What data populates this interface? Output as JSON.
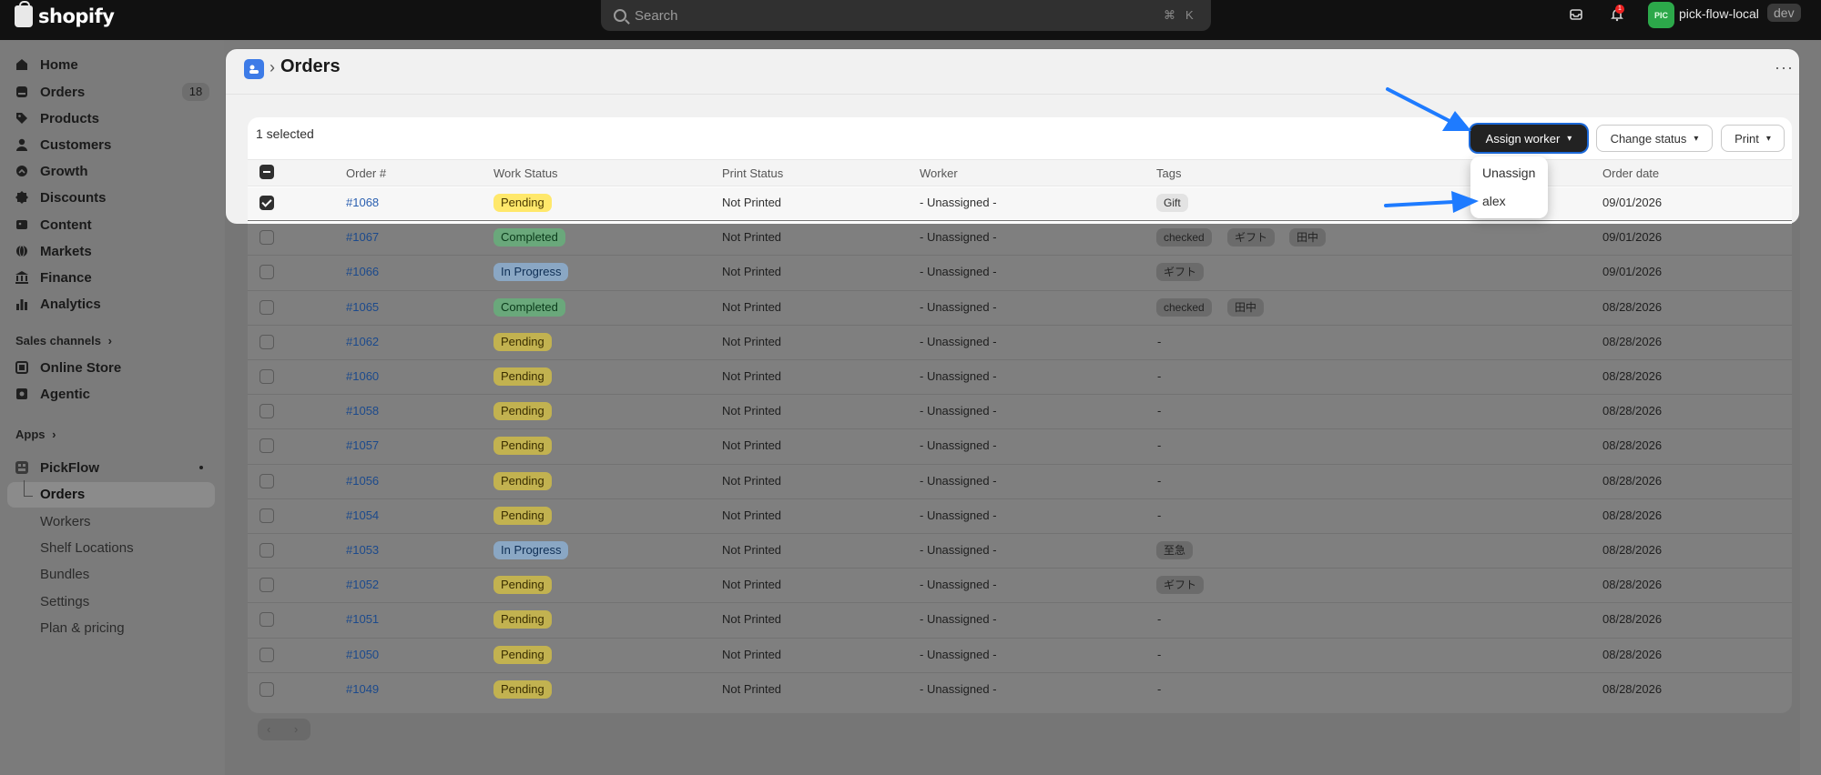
{
  "topbar": {
    "logo_text": "shopify",
    "search_placeholder": "Search",
    "shortcut_cmd": "⌘",
    "shortcut_key": "K",
    "notification_count": "1",
    "avatar_initials": "PIC",
    "store_name": "pick-flow-local",
    "store_badge": "dev"
  },
  "sidebar": {
    "items": [
      {
        "label": "Home"
      },
      {
        "label": "Orders",
        "count": "18"
      },
      {
        "label": "Products"
      },
      {
        "label": "Customers"
      },
      {
        "label": "Growth"
      },
      {
        "label": "Discounts"
      },
      {
        "label": "Content"
      },
      {
        "label": "Markets"
      },
      {
        "label": "Finance"
      },
      {
        "label": "Analytics"
      }
    ],
    "sales_channels_label": "Sales channels",
    "channels": [
      {
        "label": "Online Store"
      },
      {
        "label": "Agentic"
      }
    ],
    "apps_label": "Apps",
    "app": {
      "label": "PickFlow",
      "sub_items": [
        {
          "label": "Orders"
        },
        {
          "label": "Workers"
        },
        {
          "label": "Shelf Locations"
        },
        {
          "label": "Bundles"
        },
        {
          "label": "Settings"
        },
        {
          "label": "Plan & pricing"
        }
      ]
    }
  },
  "page": {
    "title": "Orders",
    "selection_text": "1 selected",
    "actions": {
      "assign_worker": "Assign worker",
      "change_status": "Change status",
      "print": "Print"
    },
    "dropdown": [
      "Unassign",
      "alex"
    ],
    "columns": [
      "Order #",
      "Work Status",
      "Print Status",
      "Worker",
      "Tags",
      "Order date"
    ],
    "rows": [
      {
        "order": "#1068",
        "status": "Pending",
        "print": "Not Printed",
        "worker": "- Unassigned -",
        "tags": [
          "Gift"
        ],
        "date": "09/01/2026",
        "selected": true
      },
      {
        "order": "#1067",
        "status": "Completed",
        "print": "Not Printed",
        "worker": "- Unassigned -",
        "tags": [
          "checked",
          "ギフト",
          "田中"
        ],
        "date": "09/01/2026"
      },
      {
        "order": "#1066",
        "status": "In Progress",
        "print": "Not Printed",
        "worker": "- Unassigned -",
        "tags": [
          "ギフト"
        ],
        "date": "09/01/2026"
      },
      {
        "order": "#1065",
        "status": "Completed",
        "print": "Not Printed",
        "worker": "- Unassigned -",
        "tags": [
          "checked",
          "田中"
        ],
        "date": "08/28/2026"
      },
      {
        "order": "#1062",
        "status": "Pending",
        "print": "Not Printed",
        "worker": "- Unassigned -",
        "tags": [],
        "date": "08/28/2026"
      },
      {
        "order": "#1060",
        "status": "Pending",
        "print": "Not Printed",
        "worker": "- Unassigned -",
        "tags": [],
        "date": "08/28/2026"
      },
      {
        "order": "#1058",
        "status": "Pending",
        "print": "Not Printed",
        "worker": "- Unassigned -",
        "tags": [],
        "date": "08/28/2026"
      },
      {
        "order": "#1057",
        "status": "Pending",
        "print": "Not Printed",
        "worker": "- Unassigned -",
        "tags": [],
        "date": "08/28/2026"
      },
      {
        "order": "#1056",
        "status": "Pending",
        "print": "Not Printed",
        "worker": "- Unassigned -",
        "tags": [],
        "date": "08/28/2026"
      },
      {
        "order": "#1054",
        "status": "Pending",
        "print": "Not Printed",
        "worker": "- Unassigned -",
        "tags": [],
        "date": "08/28/2026"
      },
      {
        "order": "#1053",
        "status": "In Progress",
        "print": "Not Printed",
        "worker": "- Unassigned -",
        "tags": [
          "至急"
        ],
        "date": "08/28/2026"
      },
      {
        "order": "#1052",
        "status": "Pending",
        "print": "Not Printed",
        "worker": "- Unassigned -",
        "tags": [
          "ギフト"
        ],
        "date": "08/28/2026"
      },
      {
        "order": "#1051",
        "status": "Pending",
        "print": "Not Printed",
        "worker": "- Unassigned -",
        "tags": [],
        "date": "08/28/2026"
      },
      {
        "order": "#1050",
        "status": "Pending",
        "print": "Not Printed",
        "worker": "- Unassigned -",
        "tags": [],
        "date": "08/28/2026"
      },
      {
        "order": "#1049",
        "status": "Pending",
        "print": "Not Printed",
        "worker": "- Unassigned -",
        "tags": [],
        "date": "08/28/2026"
      }
    ],
    "empty_tag": "-"
  },
  "colors": {
    "accent_blue": "#1e7bff",
    "pending_bg": "#ffe86b",
    "completed_bg": "#8fe0a8",
    "in_progress_bg": "#b6dcff"
  }
}
